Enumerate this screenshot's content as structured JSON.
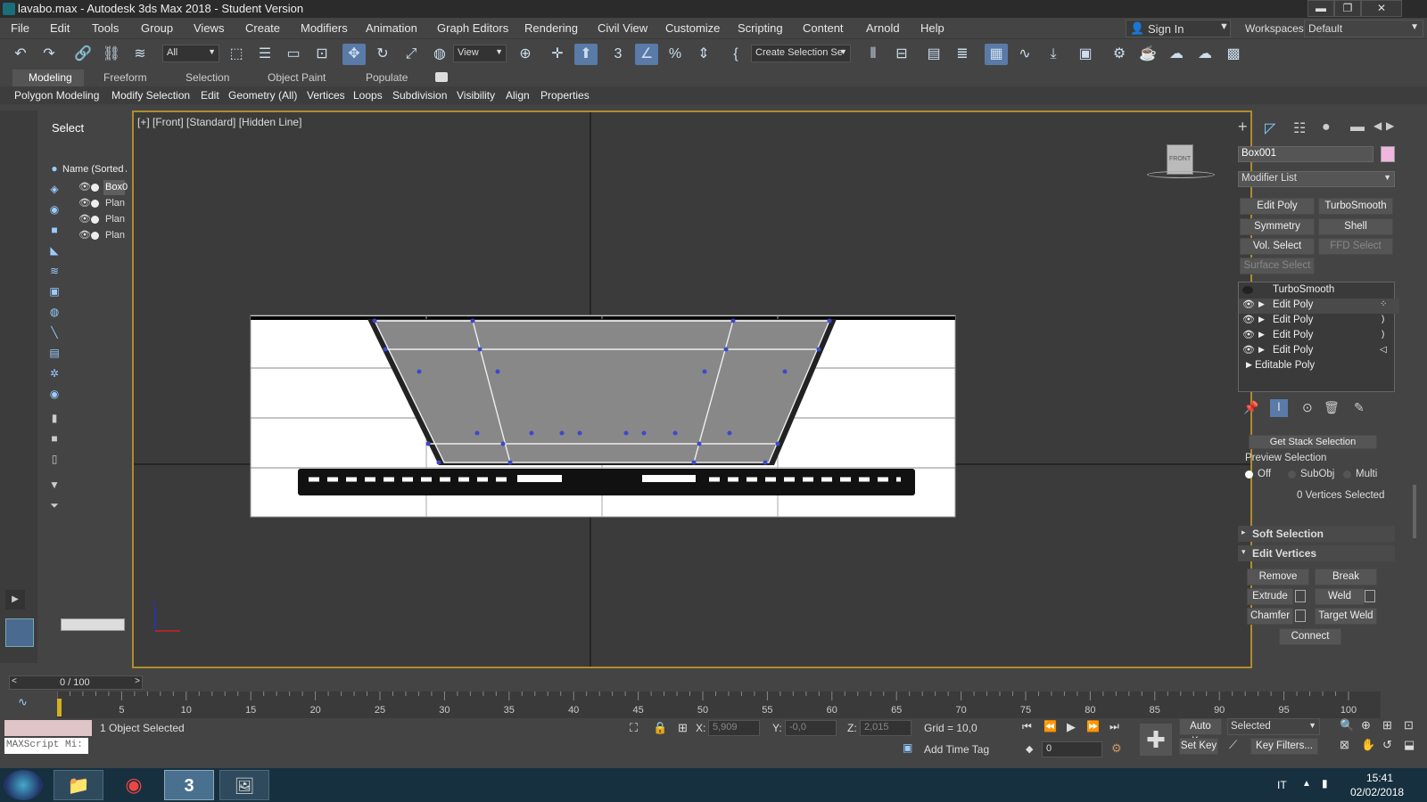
{
  "window": {
    "title": "lavabo.max - Autodesk 3ds Max 2018 - Student Version",
    "min": "▬",
    "restore": "❐",
    "close": "✕"
  },
  "menu": [
    "File",
    "Edit",
    "Tools",
    "Group",
    "Views",
    "Create",
    "Modifiers",
    "Animation",
    "Graph Editors",
    "Rendering",
    "Civil View",
    "Customize",
    "Scripting",
    "Content",
    "Arnold",
    "Help"
  ],
  "signin": {
    "label": "Sign In"
  },
  "workspaces": {
    "label": "Workspaces:",
    "value": "Default"
  },
  "toolbar": {
    "filter_value": "All",
    "ref_coord": "View",
    "selection_set": "Create Selection Se"
  },
  "ribbon_tabs": [
    "Modeling",
    "Freeform",
    "Selection",
    "Object Paint",
    "Populate"
  ],
  "ribbon_panels": [
    "Polygon Modeling",
    "Modify Selection",
    "Edit",
    "Geometry (All)",
    "Vertices",
    "Loops",
    "Subdivision",
    "Visibility",
    "Align",
    "Properties"
  ],
  "scene_explorer": {
    "title": "Select",
    "column": "Name (Sorted A",
    "items": [
      "Box0",
      "Plan",
      "Plan",
      "Plan"
    ]
  },
  "viewport": {
    "label": "[+] [Front] [Standard] [Hidden Line]",
    "viewcube": "FRONT"
  },
  "command_panel": {
    "object_name": "Box001",
    "object_color": "#f0b6e0",
    "modifier_list": "Modifier List",
    "mod_buttons": [
      {
        "label": "Edit Poly",
        "enabled": true
      },
      {
        "label": "TurboSmooth",
        "enabled": true
      },
      {
        "label": "Symmetry",
        "enabled": true
      },
      {
        "label": "Shell",
        "enabled": true
      },
      {
        "label": "Vol. Select",
        "enabled": true
      },
      {
        "label": "FFD Select",
        "enabled": false
      },
      {
        "label": "Surface Select",
        "enabled": false
      }
    ],
    "stack": [
      "TurboSmooth",
      "Edit Poly",
      "Edit Poly",
      "Edit Poly",
      "Edit Poly",
      "Editable Poly"
    ],
    "get_stack_selection": "Get Stack Selection",
    "preview_selection": "Preview Selection",
    "preview_options": [
      "Off",
      "SubObj",
      "Multi"
    ],
    "preview_selected": "Off",
    "vertices_selected": "0 Vertices Selected",
    "soft_selection": "Soft Selection",
    "edit_vertices": "Edit Vertices",
    "ev_buttons": [
      "Remove",
      "Break",
      "Extrude",
      "Weld",
      "Chamfer",
      "Target Weld",
      "Connect"
    ]
  },
  "timeline": {
    "frame": "0 / 100",
    "ticks": [
      "0",
      "5",
      "10",
      "15",
      "20",
      "25",
      "30",
      "35",
      "40",
      "45",
      "50",
      "55",
      "60",
      "65",
      "70",
      "75",
      "80",
      "85",
      "90",
      "95",
      "100"
    ],
    "current_fraction": 0.0
  },
  "status": {
    "maxscript": "MAXScript Mi:",
    "selected_text": "1 Object Selected",
    "x_label": "X:",
    "x": "5,909",
    "y_label": "Y:",
    "y": "-0,0",
    "z_label": "Z:",
    "z": "2,015",
    "grid": "Grid = 10,0",
    "add_time_tag": "Add Time Tag",
    "auto_key": "Auto Key",
    "selected_dd": "Selected",
    "set_key": "Set Key",
    "key_filters": "Key Filters...",
    "frame_value": "0"
  },
  "taskbar": {
    "lang": "IT",
    "time": "15:41",
    "date": "02/02/2018"
  }
}
